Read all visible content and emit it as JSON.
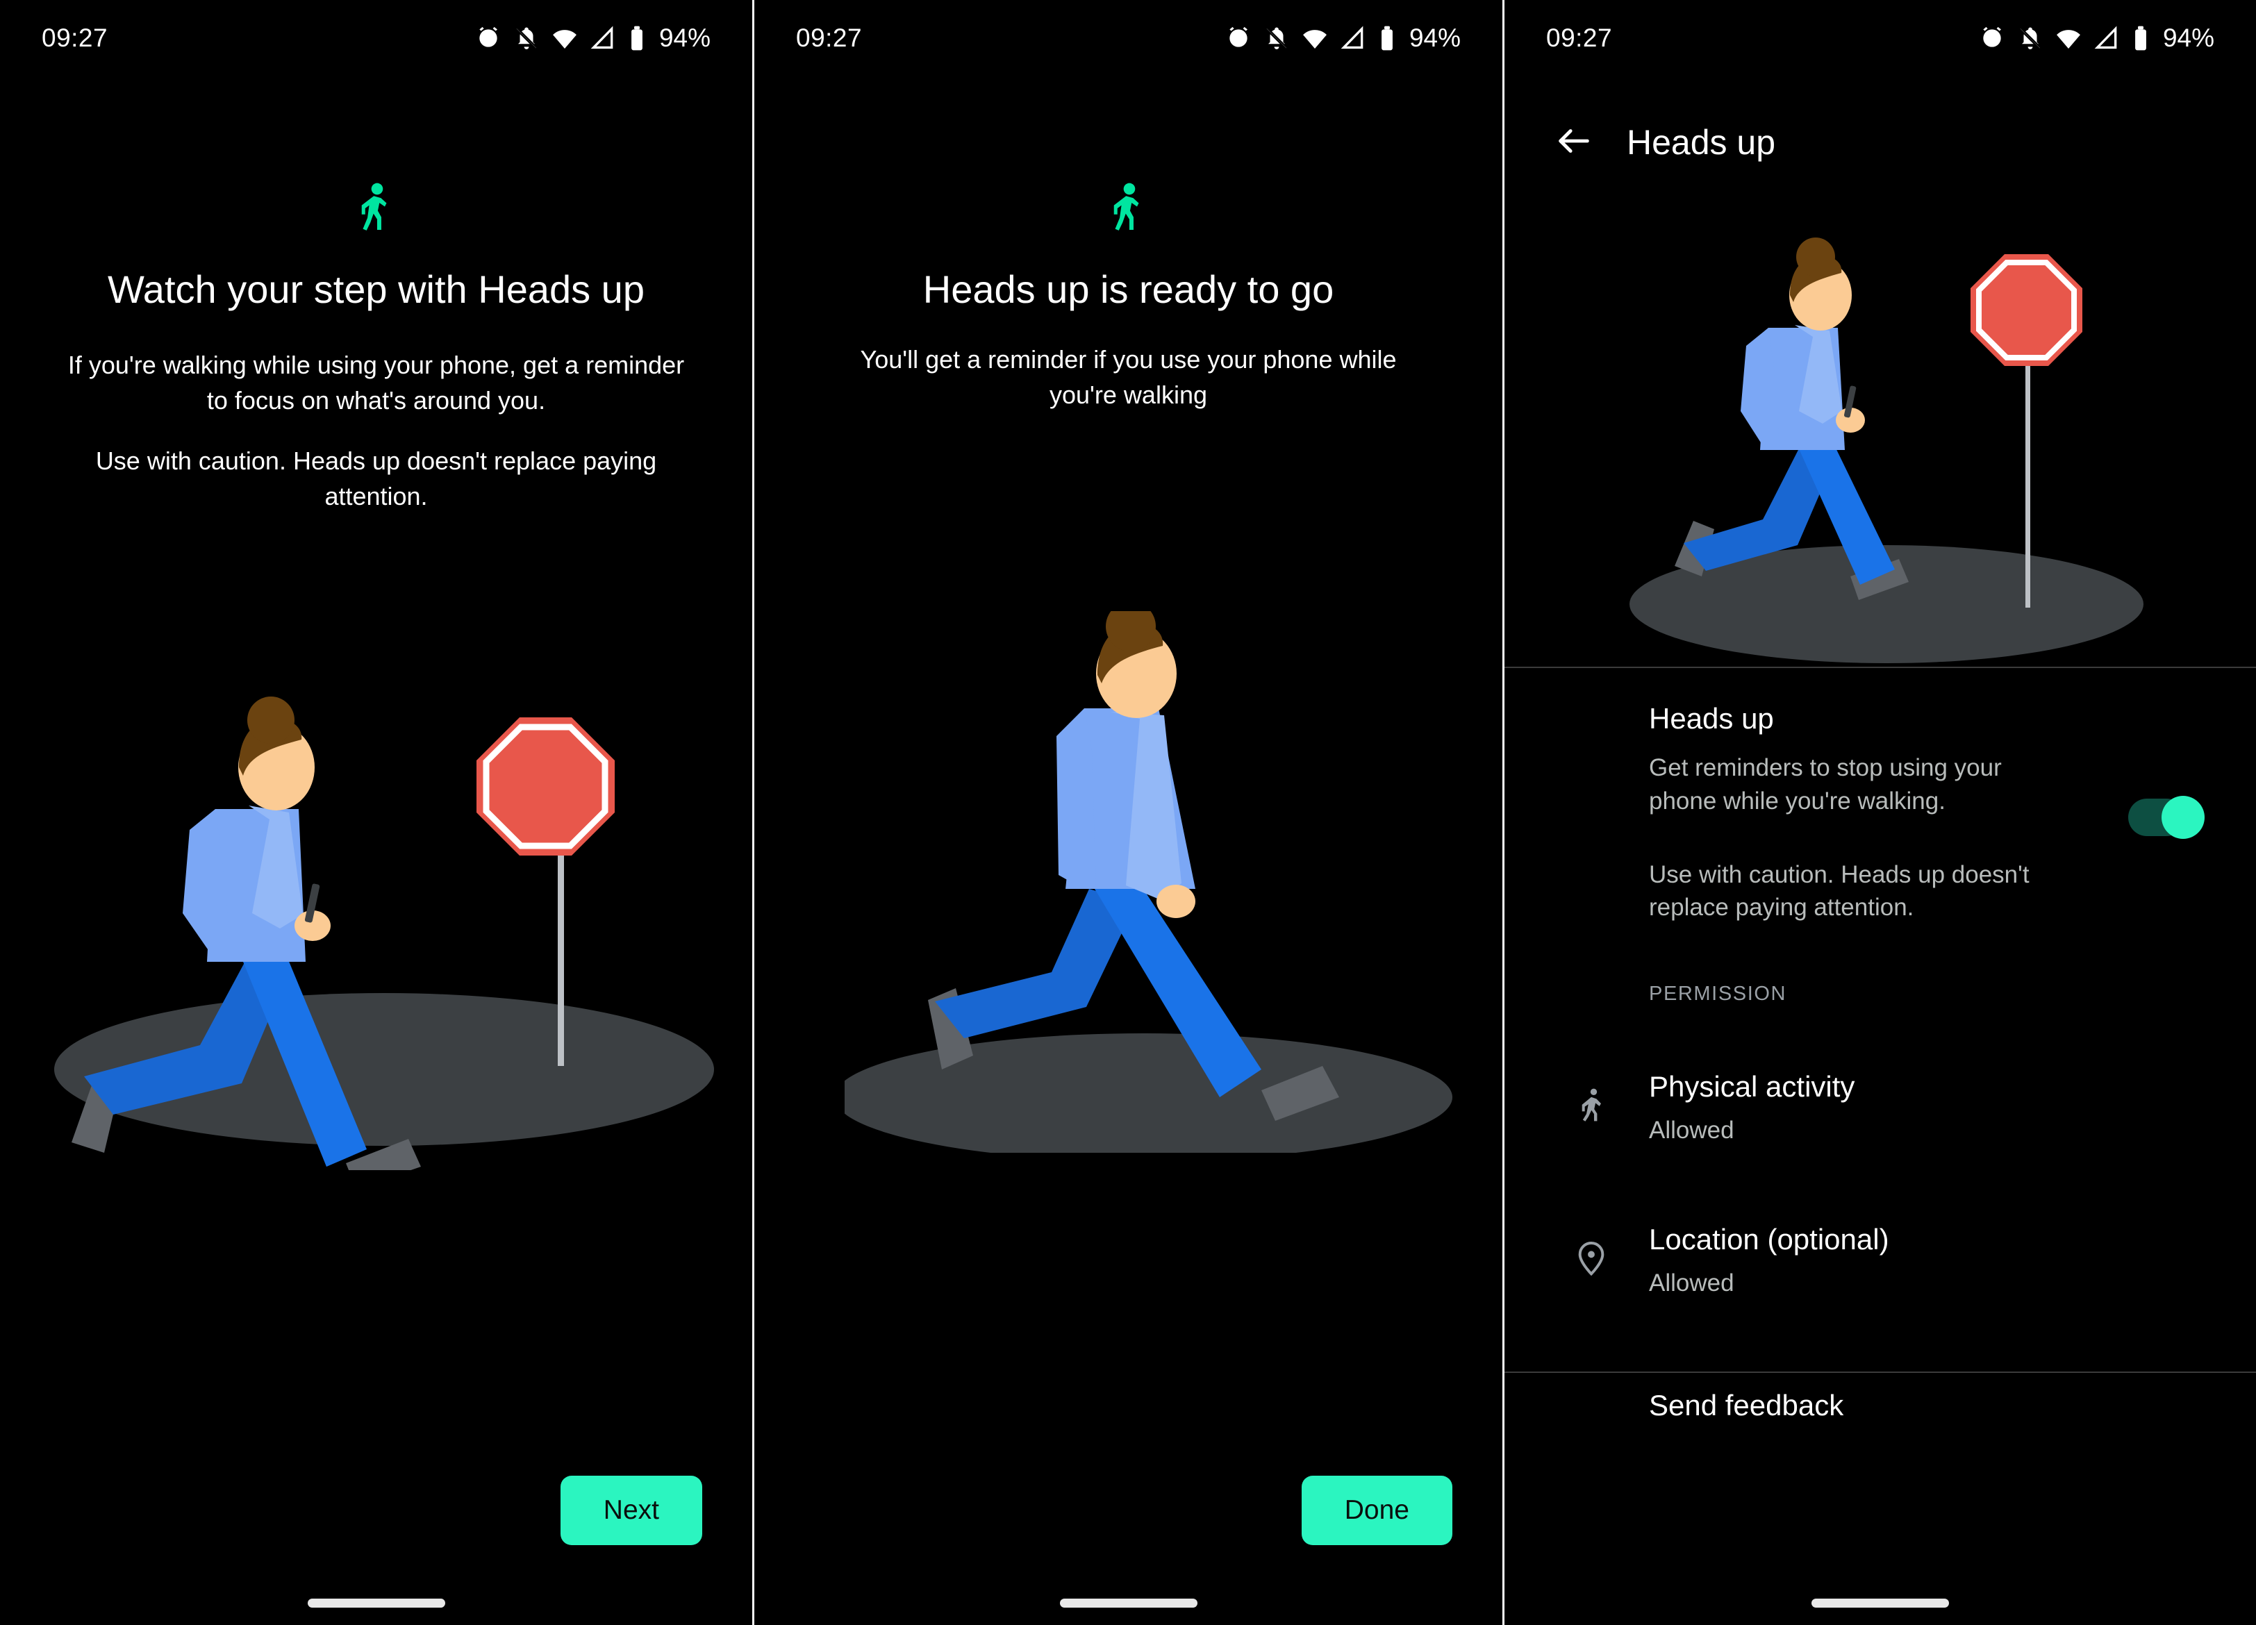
{
  "status_bar": {
    "time": "09:27",
    "battery_pct": "94%",
    "icons": [
      "alarm-icon",
      "notifications-off-icon",
      "wifi-icon",
      "cell-signal-icon",
      "battery-icon"
    ]
  },
  "theme": {
    "background": "#000000",
    "accent_green": "#2BF5C0",
    "walk_glyph_green": "#00E5A0",
    "switch_track_on": "#0D4F42",
    "text_primary": "#FFFFFF",
    "text_secondary": "#B8BCBB",
    "section_label": "#9AA0A6",
    "divider": "#3B3B3B",
    "illus_shirt": "#7BA7F5",
    "illus_shirt_arm": "#93B8F7",
    "illus_pants": "#1A73E8",
    "illus_pants_back": "#1967D2",
    "illus_skin": "#FBCB94",
    "illus_hair": "#6B4310",
    "illus_shoe": "#5F6368",
    "illus_ground": "#3C4043",
    "illus_sign_red": "#E8574B",
    "illus_sign_pole": "#BDC1C6",
    "illus_phone": "#3C4043"
  },
  "panel1": {
    "name": "heads-up-onboarding-intro",
    "glyph": "walking-person-icon",
    "title": "Watch your step with Heads up",
    "body_1": "If you're walking while using your phone, get a reminder to focus on what's around you.",
    "body_2": "Use with caution. Heads up doesn't replace paying attention.",
    "illustration": "person-walking-with-phone-and-stop-sign",
    "cta_label": "Next"
  },
  "panel2": {
    "name": "heads-up-onboarding-ready",
    "glyph": "walking-person-icon",
    "title": "Heads up is ready to go",
    "body": "You'll get a reminder if you use your phone while you're walking",
    "illustration": "person-walking-upright",
    "cta_label": "Done"
  },
  "panel3": {
    "name": "heads-up-settings",
    "appbar": {
      "back_icon": "arrow-left-icon",
      "title": "Heads up"
    },
    "illustration": "person-walking-with-phone-and-stop-sign",
    "main_setting": {
      "title": "Heads up",
      "description": "Get reminders to stop using your phone while you're walking.",
      "caution": "Use with caution. Heads up doesn't replace paying attention.",
      "toggle_state": "on"
    },
    "section_label": "PERMISSION",
    "permissions": [
      {
        "icon": "running-person-icon",
        "title": "Physical activity",
        "status": "Allowed"
      },
      {
        "icon": "location-pin-icon",
        "title": "Location (optional)",
        "status": "Allowed"
      }
    ],
    "feedback_label": "Send feedback"
  }
}
